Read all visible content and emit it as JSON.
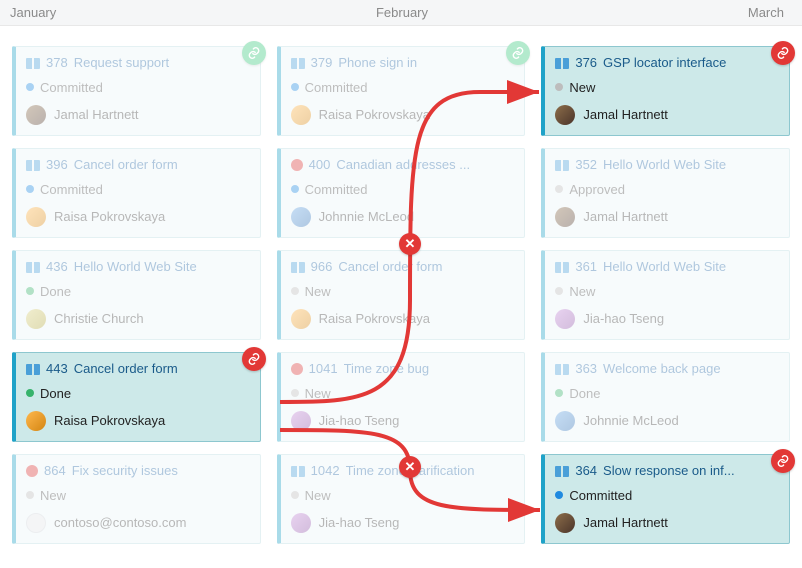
{
  "months": {
    "jan": "January",
    "feb": "February",
    "mar": "March"
  },
  "states": {
    "committed": "Committed",
    "new": "New",
    "done": "Done",
    "approved": "Approved"
  },
  "people": {
    "jamal": "Jamal Hartnett",
    "raisa": "Raisa Pokrovskaya",
    "johnnie": "Johnnie McLeod",
    "christie": "Christie Church",
    "jia": "Jia-hao Tseng",
    "contoso": "contoso@contoso.com"
  },
  "columns": {
    "jan": [
      {
        "id": "378",
        "title": "Request support",
        "state": "committed",
        "stateColor": "blue",
        "type": "book",
        "assignee": "jamal",
        "badge": "green"
      },
      {
        "id": "396",
        "title": "Cancel order form",
        "state": "committed",
        "stateColor": "blue",
        "type": "book",
        "assignee": "raisa"
      },
      {
        "id": "436",
        "title": "Hello World Web Site",
        "state": "done",
        "stateColor": "green",
        "type": "book",
        "assignee": "christie"
      },
      {
        "id": "443",
        "title": "Cancel order form",
        "state": "done",
        "stateColor": "green",
        "type": "book",
        "assignee": "raisa",
        "active": true,
        "badge": "red"
      },
      {
        "id": "864",
        "title": "Fix security issues",
        "state": "new",
        "stateColor": "gray",
        "type": "bug",
        "assignee": "contoso"
      }
    ],
    "feb": [
      {
        "id": "379",
        "title": "Phone sign in",
        "state": "committed",
        "stateColor": "blue",
        "type": "book",
        "assignee": "raisa",
        "badge": "green"
      },
      {
        "id": "400",
        "title": "Canadian addresses ...",
        "state": "committed",
        "stateColor": "blue",
        "type": "bug",
        "assignee": "johnnie"
      },
      {
        "id": "966",
        "title": "Cancel order form",
        "state": "new",
        "stateColor": "gray",
        "type": "book",
        "assignee": "raisa"
      },
      {
        "id": "1041",
        "title": "Time zone bug",
        "state": "new",
        "stateColor": "gray",
        "type": "bug",
        "assignee": "jia"
      },
      {
        "id": "1042",
        "title": "Time zone clarification",
        "state": "new",
        "stateColor": "gray",
        "type": "book",
        "assignee": "jia"
      }
    ],
    "mar": [
      {
        "id": "376",
        "title": "GSP locator interface",
        "state": "new",
        "stateColor": "gray",
        "type": "book",
        "assignee": "jamal",
        "active": true,
        "badge": "red"
      },
      {
        "id": "352",
        "title": "Hello World Web Site",
        "state": "approved",
        "stateColor": "gray",
        "type": "book",
        "assignee": "jamal"
      },
      {
        "id": "361",
        "title": "Hello World Web Site",
        "state": "new",
        "stateColor": "gray",
        "type": "book",
        "assignee": "jia"
      },
      {
        "id": "363",
        "title": "Welcome back page",
        "state": "done",
        "stateColor": "green",
        "type": "book",
        "assignee": "johnnie"
      },
      {
        "id": "364",
        "title": "Slow response on inf...",
        "state": "committed",
        "stateColor": "blue",
        "type": "book",
        "assignee": "jamal",
        "active": true,
        "badge": "red"
      }
    ]
  },
  "connectors": [
    {
      "from": "jan.3",
      "to": "mar.0",
      "blocked": true
    },
    {
      "from": "jan.3",
      "to": "mar.4",
      "blocked": true
    }
  ]
}
